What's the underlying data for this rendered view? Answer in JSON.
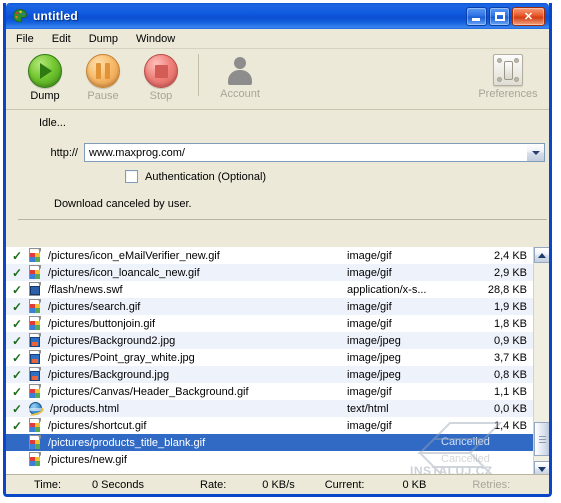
{
  "window": {
    "title": "untitled",
    "app_icon": "palette-icon",
    "buttons": {
      "minimize": "minimize-button",
      "maximize": "maximize-button",
      "close": "close-button"
    }
  },
  "menubar": {
    "items": [
      {
        "label": "File"
      },
      {
        "label": "Edit"
      },
      {
        "label": "Dump"
      },
      {
        "label": "Window"
      }
    ]
  },
  "toolbar": {
    "dump": {
      "label": "Dump",
      "enabled": true
    },
    "pause": {
      "label": "Pause",
      "enabled": false
    },
    "stop": {
      "label": "Stop",
      "enabled": false
    },
    "account": {
      "label": "Account",
      "enabled": false
    },
    "preferences": {
      "label": "Preferences",
      "enabled": false
    }
  },
  "form": {
    "status_idle": "Idle...",
    "url_label": "http://",
    "url_value": "www.maxprog.com/",
    "url_placeholder": "www.maxprog.com/",
    "auth_label": "Authentication (Optional)",
    "auth_checked": false,
    "message": "Download canceled by user."
  },
  "list": {
    "rows": [
      {
        "checked": true,
        "icon": "gif",
        "name": "/pictures/icon_eMailVerifier_new.gif",
        "mime": "image/gif",
        "size": "2,4 KB",
        "status": "",
        "selected": false
      },
      {
        "checked": true,
        "icon": "gif",
        "name": "/pictures/icon_loancalc_new.gif",
        "mime": "image/gif",
        "size": "2,9 KB",
        "status": "",
        "selected": false
      },
      {
        "checked": true,
        "icon": "swf",
        "name": "/flash/news.swf",
        "mime": "application/x-s...",
        "size": "28,8 KB",
        "status": "",
        "selected": false
      },
      {
        "checked": true,
        "icon": "gif",
        "name": "/pictures/search.gif",
        "mime": "image/gif",
        "size": "1,9 KB",
        "status": "",
        "selected": false
      },
      {
        "checked": true,
        "icon": "gif",
        "name": "/pictures/buttonjoin.gif",
        "mime": "image/gif",
        "size": "1,8 KB",
        "status": "",
        "selected": false
      },
      {
        "checked": true,
        "icon": "jpg",
        "name": "/pictures/Background2.jpg",
        "mime": "image/jpeg",
        "size": "0,9 KB",
        "status": "",
        "selected": false
      },
      {
        "checked": true,
        "icon": "jpg",
        "name": "/pictures/Point_gray_white.jpg",
        "mime": "image/jpeg",
        "size": "3,7 KB",
        "status": "",
        "selected": false
      },
      {
        "checked": true,
        "icon": "jpg",
        "name": "/pictures/Background.jpg",
        "mime": "image/jpeg",
        "size": "0,8 KB",
        "status": "",
        "selected": false
      },
      {
        "checked": true,
        "icon": "gif",
        "name": "/pictures/Canvas/Header_Background.gif",
        "mime": "image/gif",
        "size": "1,1 KB",
        "status": "",
        "selected": false
      },
      {
        "checked": true,
        "icon": "html",
        "name": "/products.html",
        "mime": "text/html",
        "size": "0,0 KB",
        "status": "",
        "selected": false
      },
      {
        "checked": true,
        "icon": "gif",
        "name": "/pictures/shortcut.gif",
        "mime": "image/gif",
        "size": "1,4 KB",
        "status": "",
        "selected": false
      },
      {
        "checked": false,
        "icon": "gif",
        "name": "/pictures/products_title_blank.gif",
        "mime": "",
        "size": "",
        "status": "Cancelled",
        "selected": true
      },
      {
        "checked": false,
        "icon": "gif",
        "name": "/pictures/new.gif",
        "mime": "",
        "size": "",
        "status": "Cancelled",
        "selected": false
      }
    ]
  },
  "scrollbar": {
    "up_icon": "chevron-up-icon",
    "down_icon": "chevron-down-icon"
  },
  "statusbar": {
    "time_label": "Time:",
    "time_value": "0 Seconds",
    "rate_label": "Rate:",
    "rate_value": "0  KB/s",
    "current_label": "Current:",
    "current_value": "0  KB",
    "retries_label": "Retries:",
    "retries_value": ""
  },
  "watermark": {
    "text": "INSTALUJ.CZ"
  },
  "colors": {
    "titlebar_blue": "#0a56d6",
    "window_border": "#0a46c8",
    "face": "#ece9d8",
    "selection": "#316ac5",
    "row_alt": "#eef2fb"
  }
}
